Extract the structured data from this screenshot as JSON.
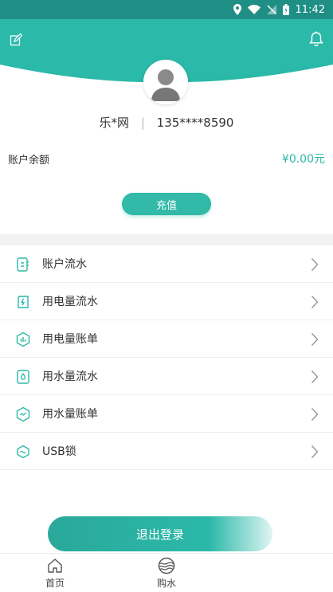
{
  "status_bar": {
    "time": "11:42"
  },
  "profile": {
    "name": "乐*网",
    "phone": "135****8590"
  },
  "balance": {
    "label": "账户余额",
    "amount": "¥0.00元"
  },
  "recharge_label": "充值",
  "menu": [
    {
      "label": "账户流水",
      "icon": "statement-icon"
    },
    {
      "label": "用电量流水",
      "icon": "electricity-flow-icon"
    },
    {
      "label": "用电量账单",
      "icon": "electricity-bill-icon"
    },
    {
      "label": "用水量流水",
      "icon": "water-flow-icon"
    },
    {
      "label": "用水量账单",
      "icon": "water-bill-icon"
    },
    {
      "label": "USB锁",
      "icon": "usb-lock-icon"
    }
  ],
  "logout_label": "退出登录",
  "tabs": [
    {
      "label": "首页",
      "icon": "home-icon"
    },
    {
      "label": "购水",
      "icon": "buy-water-icon"
    }
  ],
  "colors": {
    "primary": "#2bb9a9",
    "status_bar": "#1f8f86"
  }
}
